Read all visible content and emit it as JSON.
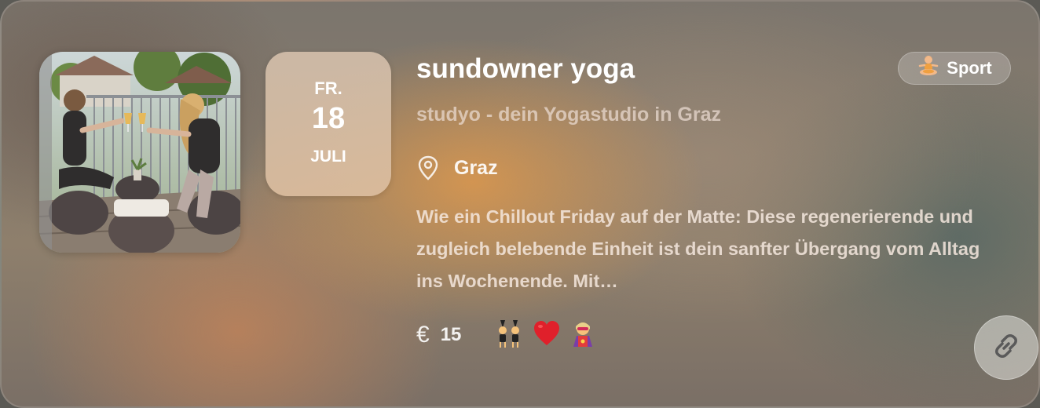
{
  "event": {
    "title": "sundowner yoga",
    "organizer": "studyo - dein Yogastudio in Graz",
    "location": "Graz",
    "description": "Wie ein Chillout Friday auf der Matte: Diese regenerierende und zugleich belebende Einheit ist dein sanfter Übergang vom Alltag ins Wochenende. Mit…",
    "category": "Sport",
    "category_icon": "person-in-lotus-position-icon"
  },
  "date": {
    "weekday": "FR.",
    "day": "18",
    "month": "JULI"
  },
  "price": {
    "currency_icon": "euro-icon",
    "amount": "15"
  },
  "tags": [
    {
      "icon": "women-with-bunny-ears-icon"
    },
    {
      "icon": "red-heart-icon"
    },
    {
      "icon": "woman-superhero-icon"
    }
  ],
  "image": {
    "icon": "event-photo-two-women-toasting-on-terrace"
  },
  "colors": {
    "text": "#ffffff",
    "accent_orange": "#d6964f",
    "muted_text": "#ebdcd2"
  }
}
